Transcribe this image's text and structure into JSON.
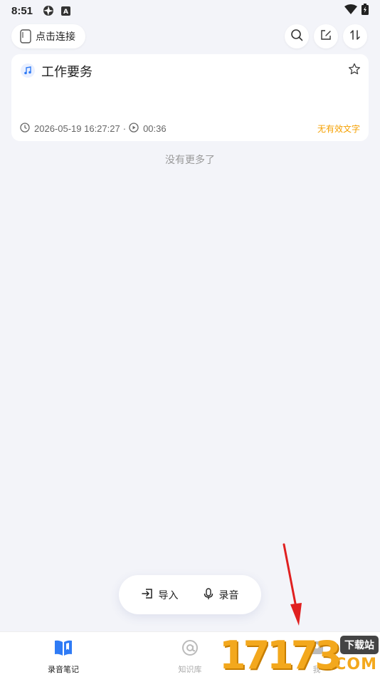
{
  "status_bar": {
    "time": "8:51"
  },
  "top_bar": {
    "connect_label": "点击连接"
  },
  "recordings": [
    {
      "title": "工作要务",
      "datetime": "2026-05-19 16:27:27",
      "separator": "·",
      "duration": "00:36",
      "status": "无有效文字"
    }
  ],
  "list_footer": "没有更多了",
  "actions": {
    "import_label": "导入",
    "record_label": "录音"
  },
  "bottom_nav": [
    {
      "label": "录音笔记",
      "icon": "book-icon",
      "active": true
    },
    {
      "label": "知识库",
      "icon": "at-icon",
      "active": false
    },
    {
      "label": "我",
      "icon": "profile-icon",
      "active": false
    }
  ],
  "watermark": {
    "number": "17173",
    "tag": "下载站",
    "domain": ".COM"
  },
  "colors": {
    "accent": "#2f7bf5",
    "warning": "#f5a000",
    "background": "#f3f4f9",
    "arrow": "#e02020"
  }
}
